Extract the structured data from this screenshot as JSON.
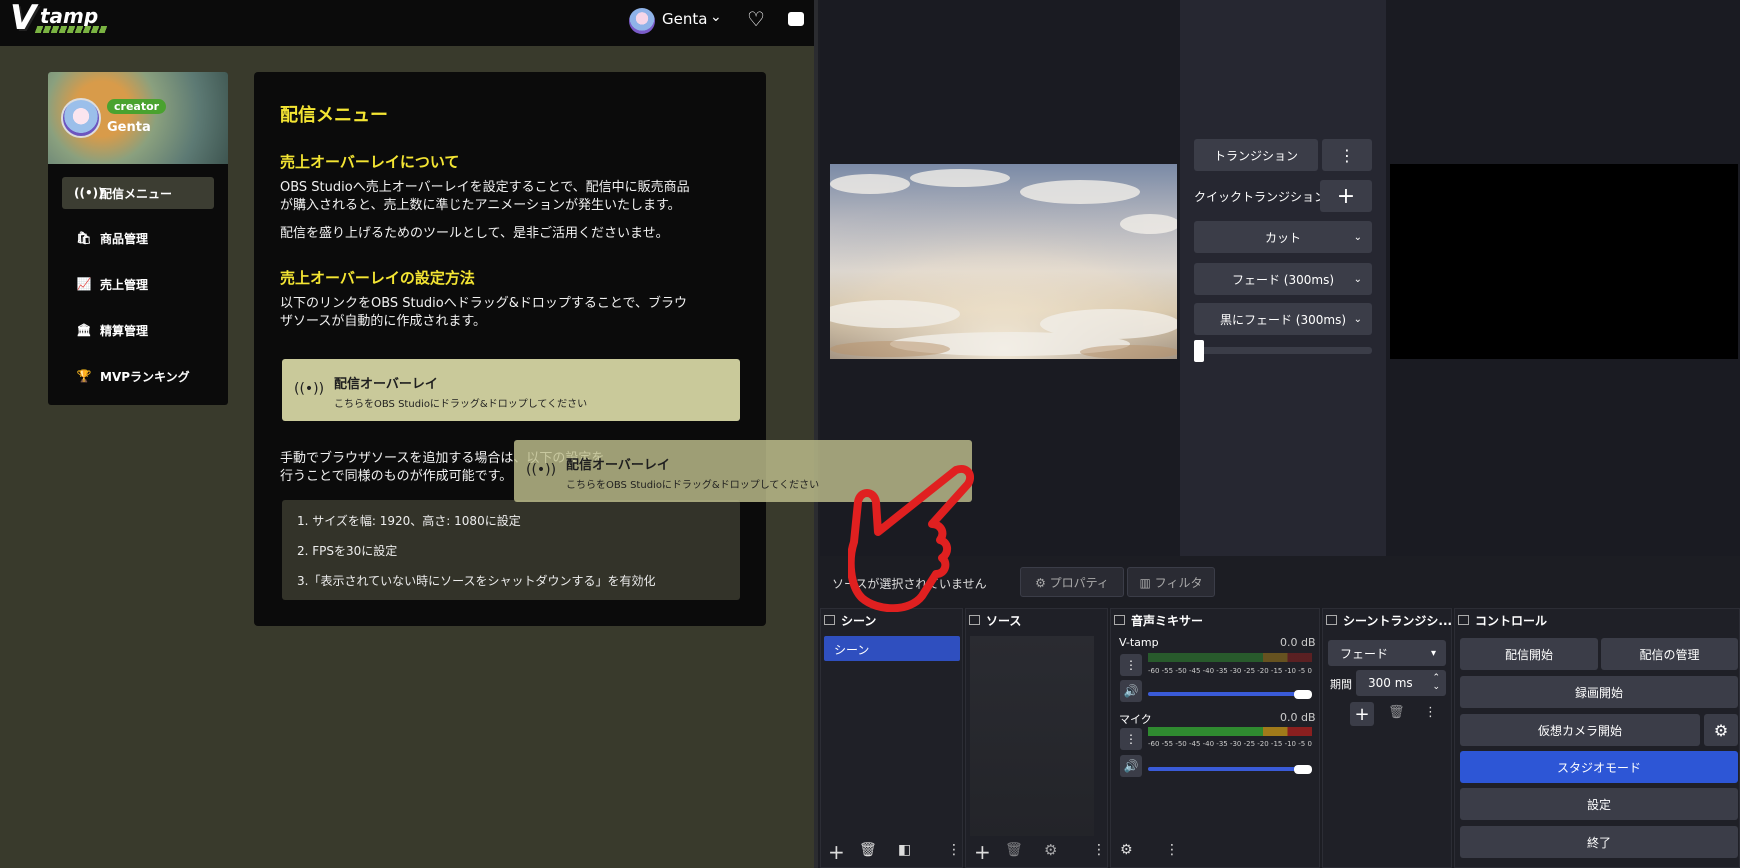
{
  "web": {
    "logo": {
      "v": "V",
      "text": "tamp"
    },
    "header": {
      "user_name": "Genta",
      "chevron": "⌄",
      "heart": "♡"
    },
    "profile": {
      "badge": "creator",
      "name": "Genta"
    },
    "menu": [
      {
        "icon": "((•))",
        "label": "配信メニュー"
      },
      {
        "icon": "🛍",
        "label": "商品管理"
      },
      {
        "icon": "📈",
        "label": "売上管理"
      },
      {
        "icon": "🏛",
        "label": "精算管理"
      },
      {
        "icon": "🏆",
        "label": "MVPランキング"
      }
    ],
    "panel": {
      "title": "配信メニュー",
      "section1_title": "売上オーバーレイについて",
      "section1_p1a": "OBS Studioへ売上オーバーレイを設定することで、配信中に販売商品",
      "section1_p1b": "が購入されると、売上数に準じたアニメーションが発生いたします。",
      "section1_p2": "配信を盛り上げるためのツールとして、是非ご活用くださいませ。",
      "section2_title": "売上オーバーレイの設定方法",
      "section2_p1a": "以下のリンクをOBS Studioへドラッグ&ドロップすることで、ブラウ",
      "section2_p1b": "ザソースが自動的に作成されます。",
      "overlay_icon": "((•))",
      "overlay_title": "配信オーバーレイ",
      "overlay_sub": "こちらをOBS Studioにドラッグ&ドロップしてください",
      "manual_a": "手動でブラウザソースを追加する場合は、以下の設定を",
      "manual_b": "行うことで同様のものが作成可能です。",
      "steps": [
        "1. サイズを幅: 1920、高さ: 1080に設定",
        "2. FPSを30に設定",
        "3.「表示されていない時にソースをシャットダウンする」を有効化"
      ]
    },
    "drag_ghost": {
      "icon": "((•))",
      "title": "配信オーバーレイ",
      "sub": "こちらをOBS Studioにドラッグ&ドロップしてください"
    }
  },
  "obs": {
    "transition_btn": "トランジション",
    "more": "⋮",
    "quick_transition": "クイックトランジション",
    "plus": "+",
    "quick_items": [
      "カット",
      "フェード (300ms)",
      "黒にフェード (300ms)"
    ],
    "caret": "⌄",
    "no_source": "ソースが選択されていません",
    "properties_btn": "⚙ プロパティ",
    "filter_btn": "▥ フィルタ",
    "docks": {
      "scenes": "シーン",
      "sources": "ソース",
      "mixer": "音声ミキサー",
      "transitions": "シーントランジシ...",
      "controls": "コントロール"
    },
    "scene_item": "シーン",
    "mixer": [
      {
        "name": "V-tamp",
        "db": "0.0 dB"
      },
      {
        "name": "マイク",
        "db": "0.0 dB"
      }
    ],
    "meter_scale": "-60 -55 -50 -45 -40 -35 -30 -25 -20 -15 -10 -5 0",
    "scene_transition": {
      "type": "フェード",
      "period_label": "期間",
      "period_value": "300 ms"
    },
    "controls": [
      "配信開始",
      "配信の管理",
      "録画開始",
      "仮想カメラ開始",
      "スタジオモード",
      "設定",
      "終了"
    ],
    "icons": {
      "add": "+",
      "remove": "🗑",
      "filter": "◧",
      "gear": "⚙",
      "more": "⋮",
      "speaker": "🔊",
      "stepper_up": "⌃",
      "stepper_down": "⌄",
      "dropdown": "▾"
    }
  },
  "colors": {
    "accent_yellow": "#f4e533",
    "creator_green": "#4aa22f",
    "obs_blue": "#2d56d6",
    "overlay_card": "#c9c99a",
    "hand_red": "#e02020"
  }
}
